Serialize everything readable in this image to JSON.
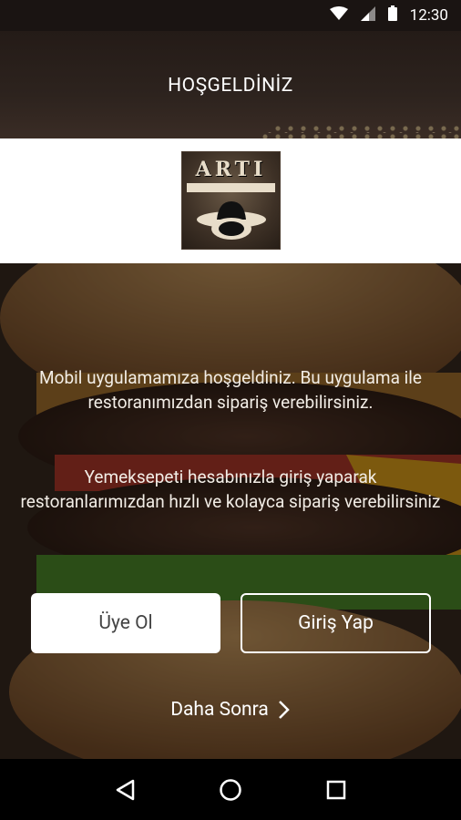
{
  "status_bar": {
    "time": "12:30"
  },
  "header": {
    "title": "HOŞGELDİNİZ"
  },
  "logo": {
    "text": "ARTI"
  },
  "welcome": {
    "line1": "Mobil uygulamamıza hoşgeldiniz. Bu uygulama ile restoranımızdan sipariş verebilirsiniz.",
    "line2": "Yemeksepeti hesabınızla giriş yaparak restoranlarımızdan hızlı ve kolayca sipariş verebilirsiniz"
  },
  "buttons": {
    "register": "Üye Ol",
    "login": "Giriş Yap",
    "later": "Daha Sonra"
  }
}
